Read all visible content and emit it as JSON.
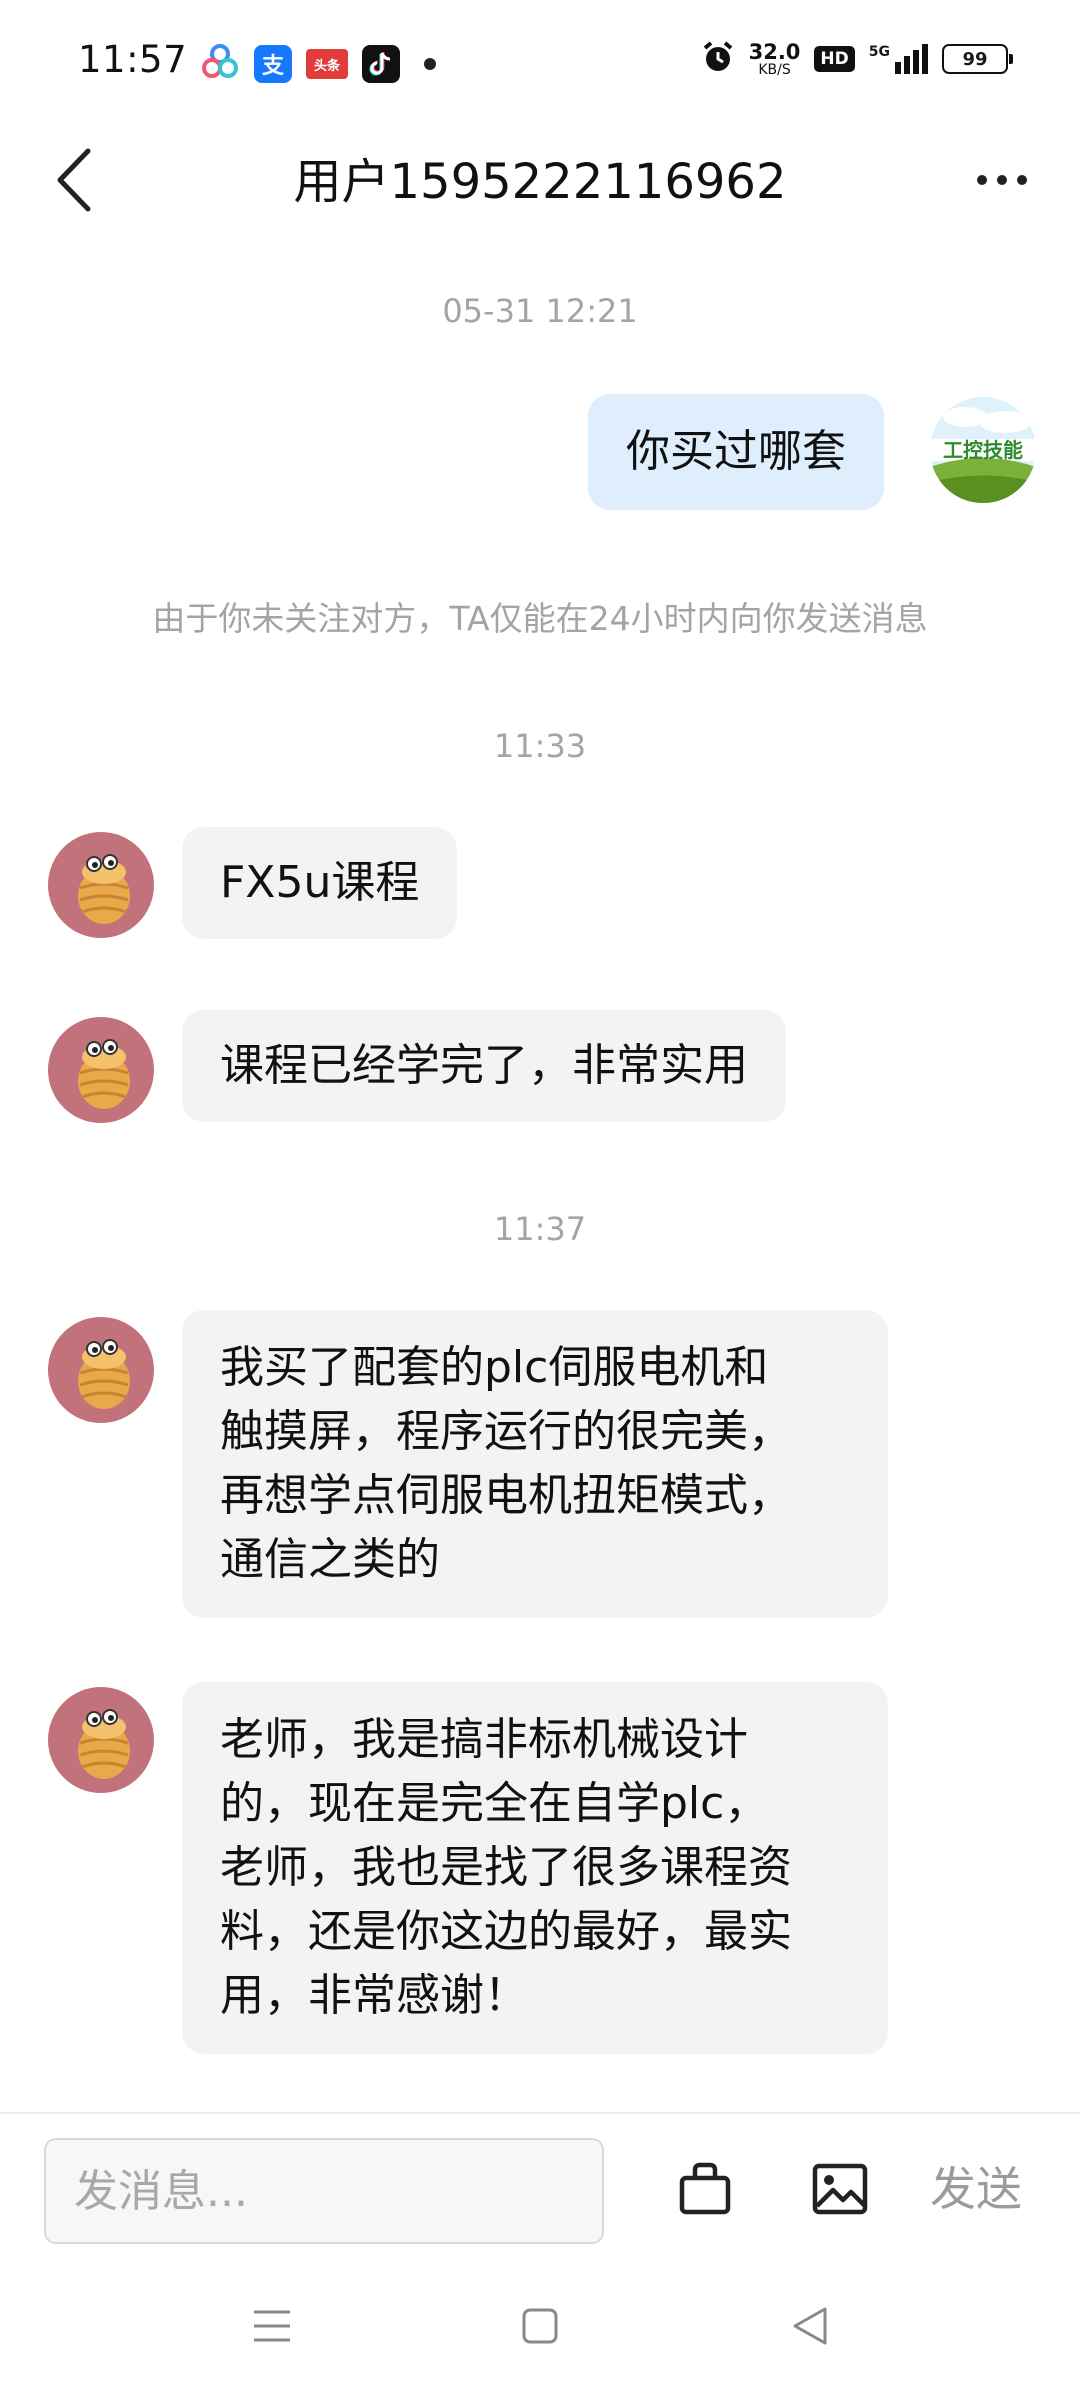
{
  "status_bar": {
    "time": "11:57",
    "net_speed_value": "32.0",
    "net_speed_unit": "KB/S",
    "hd_label": "HD",
    "network_label": "5G",
    "battery_level": "99",
    "notification_apps": [
      "baidu-netdisk-icon",
      "alipay-icon",
      "toutiao-icon",
      "tiktok-icon"
    ],
    "alipay_glyph": "支",
    "toutiao_glyph": "头条"
  },
  "header": {
    "title": "用户1595222116962"
  },
  "messages": {
    "time_1": "05-31 12:21",
    "out_1": "你买过哪套",
    "notice": "由于你未关注对方，TA仅能在24小时内向你发送消息",
    "time_2": "11:33",
    "in_1": "FX5u课程",
    "in_2": "课程已经学完了，非常实用",
    "time_3": "11:37",
    "in_3_lines": [
      "我买了配套的plc伺服电机和",
      "触摸屏，程序运行的很完美，",
      "再想学点伺服电机扭矩模式，",
      "通信之类的"
    ],
    "in_4_lines": [
      "老师，我是搞非标机械设计",
      "的，现在是完全在自学plc，",
      "老师，我也是找了很多课程资",
      "料，还是你这边的最好，最实",
      "用，非常感谢！"
    ],
    "my_avatar_text": "工控技能"
  },
  "input_bar": {
    "placeholder": "发消息...",
    "send_label": "发送"
  },
  "colors": {
    "out_bubble": "#dfeefc",
    "in_bubble": "#f2f3f5",
    "muted_text": "#a4a4a4",
    "avatar_bg": "#c2727a"
  }
}
